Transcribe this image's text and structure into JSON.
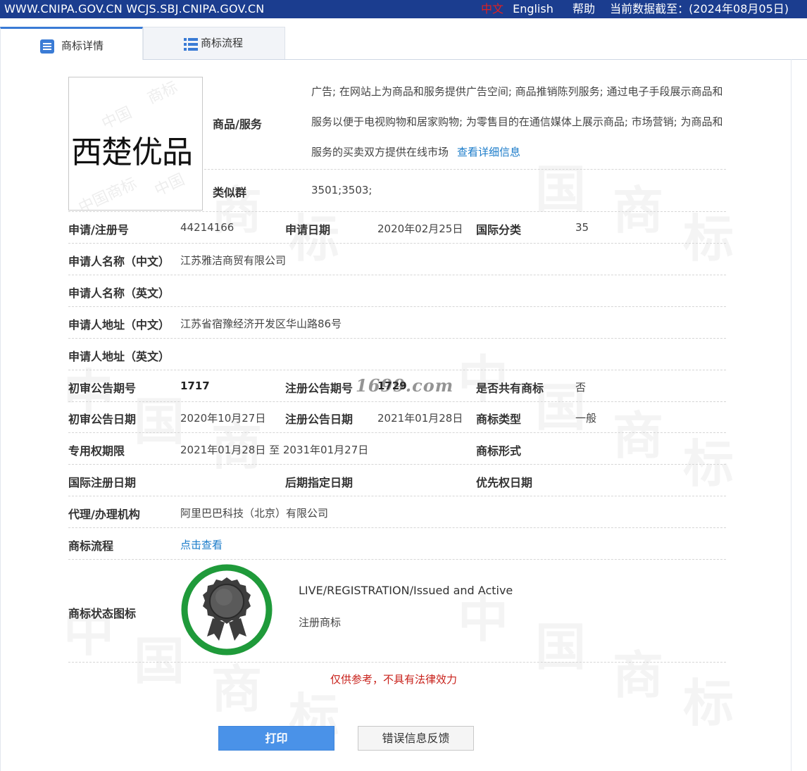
{
  "topbar": {
    "site": "WWW.CNIPA.GOV.CN WCJS.SBJ.CNIPA.GOV.CN",
    "lang_cn": "中文",
    "lang_en": "English",
    "help": "帮助",
    "data_date": "当前数据截至：(2024年08月05日)"
  },
  "tabs": [
    {
      "label": "商标详情",
      "icon": "document-list-icon"
    },
    {
      "label": "商标流程",
      "icon": "list-icon"
    }
  ],
  "trademark": {
    "name": "西楚优品",
    "goods_label": "商品/服务",
    "goods_text": "广告; 在网站上为商品和服务提供广告空间; 商品推销陈列服务; 通过电子手段展示商品和服务以便于电视购物和居家购物; 为零售目的在通信媒体上展示商品; 市场营销; 为商品和服务的买卖双方提供在线市场",
    "goods_more": "查看详细信息",
    "similar_group_label": "类似群",
    "similar_group": "3501;3503;"
  },
  "details": {
    "reg_no_label": "申请/注册号",
    "reg_no": "44214166",
    "apply_date_label": "申请日期",
    "apply_date": "2020年02月25日",
    "intl_class_label": "国际分类",
    "intl_class": "35",
    "applicant_cn_label": "申请人名称（中文）",
    "applicant_cn": "江苏雅洁商贸有限公司",
    "applicant_en_label": "申请人名称（英文）",
    "applicant_en": "",
    "address_cn_label": "申请人地址（中文）",
    "address_cn": "江苏省宿豫经济开发区华山路86号",
    "address_en_label": "申请人地址（英文）",
    "address_en": "",
    "prelim_no_label": "初审公告期号",
    "prelim_no": "1717",
    "reg_pub_no_label": "注册公告期号",
    "reg_pub_no": "1729",
    "shared_label": "是否共有商标",
    "shared": "否",
    "prelim_date_label": "初审公告日期",
    "prelim_date": "2020年10月27日",
    "reg_pub_date_label": "注册公告日期",
    "reg_pub_date": "2021年01月28日",
    "mark_type_label": "商标类型",
    "mark_type": "一般",
    "exclusive_label": "专用权期限",
    "exclusive": "2021年01月28日 至 2031年01月27日",
    "mark_form_label": "商标形式",
    "mark_form": "",
    "intl_reg_date_label": "国际注册日期",
    "later_designation_label": "后期指定日期",
    "priority_date_label": "优先权日期",
    "agent_label": "代理/办理机构",
    "agent": "阿里巴巴科技（北京）有限公司",
    "process_label": "商标流程",
    "process_link": "点击查看",
    "status_icon_label": "商标状态图标",
    "status_en": "LIVE/REGISTRATION/Issued and Active",
    "status_cn": "注册商标"
  },
  "overlay_watermark": "1699.com",
  "disclaimer": "仅供参考，不具有法律效力",
  "buttons": {
    "print": "打印",
    "feedback": "错误信息反馈"
  },
  "colors": {
    "topbar": "#1b3d8f",
    "link": "#1a7bc9",
    "badge_ring": "#1f9a3a",
    "print_button": "#4a92e8",
    "disclaimer": "#c8201a"
  }
}
